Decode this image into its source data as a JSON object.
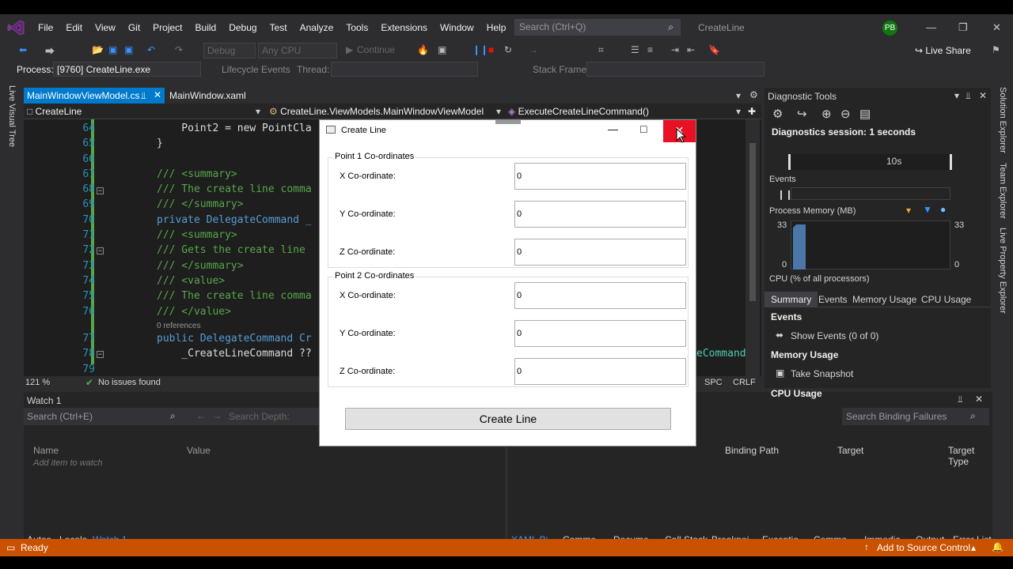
{
  "menu": [
    "File",
    "Edit",
    "View",
    "Git",
    "Project",
    "Build",
    "Debug",
    "Test",
    "Analyze",
    "Tools",
    "Extensions",
    "Window",
    "Help"
  ],
  "search": {
    "placeholder": "Search (Ctrl+Q)"
  },
  "solution_name": "CreateLine",
  "user_initials": "PB",
  "toolbar": {
    "config": "Debug",
    "platform": "Any CPU",
    "continue": "Continue",
    "live_share": "Live Share"
  },
  "process_bar": {
    "process_label": "Process:",
    "process_value": "[9760] CreateLine.exe",
    "lifecycle": "Lifecycle Events",
    "thread": "Thread:",
    "stack_frame": "Stack Frame:"
  },
  "left_strip": "Live Visual Tree",
  "right_strip": [
    "Solution Explorer",
    "Team Explorer",
    "Live Property Explorer"
  ],
  "doc_tabs": [
    "MainWindowViewModel.cs",
    "MainWindow.xaml"
  ],
  "nav": {
    "project": "CreateLine",
    "class": "CreateLine.ViewModels.MainWindowViewModel",
    "member": "ExecuteCreateLineCommand()"
  },
  "code_lines": [
    {
      "n": "64",
      "t": "    Point2 = new PointCla"
    },
    {
      "n": "65",
      "t": "}"
    },
    {
      "n": "66",
      "t": ""
    },
    {
      "n": "67",
      "t": "/// <summary>"
    },
    {
      "n": "68",
      "t": "/// The create line comma"
    },
    {
      "n": "69",
      "t": "/// </summary>"
    },
    {
      "n": "70",
      "t": "private DelegateCommand _"
    },
    {
      "n": "71",
      "t": "/// <summary>"
    },
    {
      "n": "72",
      "t": "/// Gets the create line"
    },
    {
      "n": "73",
      "t": "/// </summary>"
    },
    {
      "n": "74",
      "t": "/// <value>"
    },
    {
      "n": "75",
      "t": "/// The create line comma"
    },
    {
      "n": "76",
      "t": "/// </value>"
    },
    {
      "n": "77",
      "t": "public DelegateCommand Cr"
    },
    {
      "n": "78",
      "t": "    _CreateLineCommand ??"
    },
    {
      "n": "79",
      "t": ""
    }
  ],
  "references": "0 references",
  "code_overflow": "eCommand",
  "editor_status": {
    "zoom": "121 %",
    "issues": "No issues found",
    "spc": "SPC",
    "crlf": "CRLF"
  },
  "watch": {
    "title": "Watch 1",
    "search": "Search (Ctrl+E)",
    "depth": "Search Depth:",
    "col_name": "Name",
    "col_value": "Value",
    "add_item": "Add item to watch",
    "tabs": [
      "Autos",
      "Locals",
      "Watch 1"
    ]
  },
  "binding": {
    "search": "Search Binding Failures",
    "cols": [
      "Binding Path",
      "Target",
      "Target Type"
    ],
    "tabs": [
      "XAML Bi...",
      "Comme...",
      "Docume...",
      "Call Stack",
      "Breakpoi...",
      "Exceptio...",
      "Comma...",
      "Immedia...",
      "Output",
      "Error List"
    ]
  },
  "diag": {
    "title": "Diagnostic Tools",
    "session": "Diagnostics session: 1 seconds",
    "timeline": "10s",
    "events": "Events",
    "memory": "Process Memory (MB)",
    "mem_max": "33",
    "mem_min": "0",
    "cpu": "CPU (% of all processors)",
    "tabs": [
      "Summary",
      "Events",
      "Memory Usage",
      "CPU Usage"
    ],
    "sec_events": "Events",
    "show_events": "Show Events (0 of 0)",
    "sec_mem": "Memory Usage",
    "snapshot": "Take Snapshot",
    "sec_cpu": "CPU Usage"
  },
  "status": {
    "ready": "Ready",
    "source": "Add to Source Control"
  },
  "dialog": {
    "title": "Create Line",
    "group1": "Point 1 Co-ordinates",
    "group2": "Point 2 Co-ordinates",
    "x_label": "X Co-ordinate:",
    "y_label": "Y Co-ordinate:",
    "z_label": "Z Co-ordinate:",
    "p1": {
      "x": "0",
      "y": "0",
      "z": "0"
    },
    "p2": {
      "x": "0",
      "y": "0",
      "z": "0"
    },
    "button": "Create Line"
  },
  "colors": {
    "accent": "#007acc",
    "status_bar": "#ca5100",
    "close_red": "#e81123"
  }
}
